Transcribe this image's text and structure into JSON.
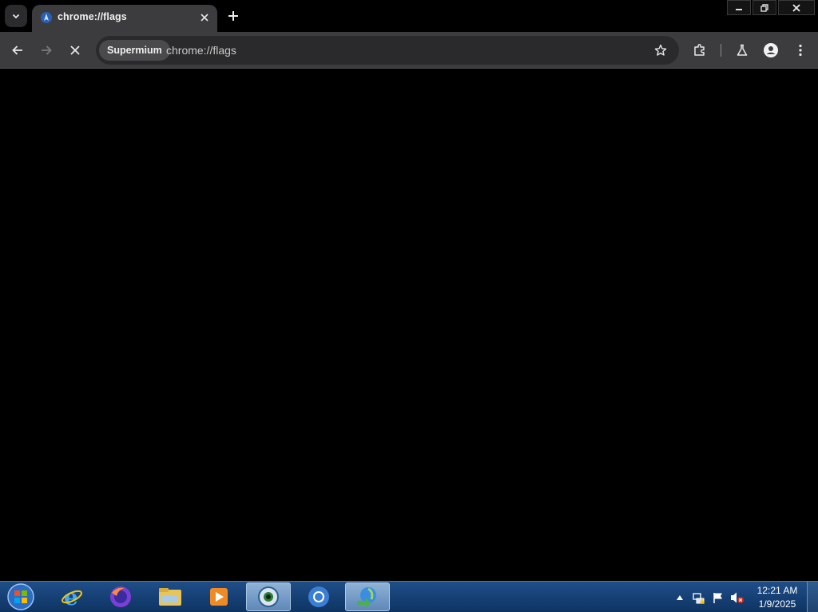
{
  "browser": {
    "tab": {
      "title": "chrome://flags",
      "favicon": "supermium-icon"
    },
    "omnibox": {
      "chip_label": "Supermium",
      "url": "chrome://flags"
    },
    "icons": {
      "tab_search": "chevron-down-icon",
      "tab_close": "close-icon",
      "new_tab": "plus-icon",
      "back": "back-arrow-icon",
      "forward": "forward-arrow-icon",
      "stop": "stop-icon",
      "bookmark": "star-icon",
      "extensions": "puzzle-icon",
      "labs": "flask-icon",
      "profile": "profile-icon",
      "menu": "kebab-menu-icon",
      "minimize": "minimize-icon",
      "restore": "restore-icon",
      "close_window": "close-icon"
    },
    "colors": {
      "toolbar": "#3c3c3e",
      "tab_active": "#3c3c3e",
      "omnibox": "#2a2a2c",
      "content": "#000000"
    }
  },
  "taskbar": {
    "clock": {
      "time": "12:21 AM",
      "date": "1/9/2025"
    },
    "apps": [
      "start-orb-icon",
      "internet-explorer-icon",
      "firefox-icon",
      "file-explorer-icon",
      "media-player-icon",
      "eye-app-icon",
      "chromium-icon",
      "download-manager-icon"
    ],
    "tray": [
      "show-hidden-icons-icon",
      "network-icon",
      "action-center-flag-icon",
      "volume-muted-icon"
    ],
    "colors": {
      "bar": "#1f4e88"
    }
  }
}
